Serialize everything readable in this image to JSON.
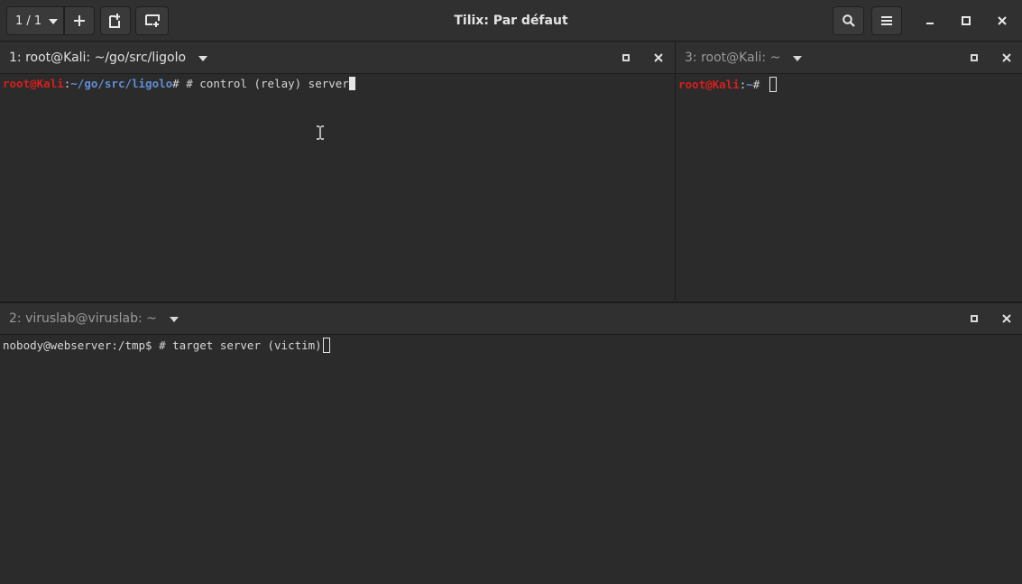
{
  "window": {
    "title": "Tilix: Par défaut",
    "session_counter": "1 / 1"
  },
  "icons": {
    "add": "plus-icon",
    "add_right": "add-terminal-right-icon",
    "add_down": "add-terminal-down-icon",
    "search": "search-icon",
    "menu": "hamburger-menu-icon",
    "minimize": "minimize-icon",
    "maximize": "maximize-icon",
    "close": "close-icon"
  },
  "panes": [
    {
      "title": "1: root@Kali: ~/go/src/ligolo",
      "prompt_user": "root@Kali",
      "prompt_sep": ":",
      "prompt_path": "~/go/src/ligolo",
      "prompt_symbol": "# ",
      "command": "# control (relay) server"
    },
    {
      "title": "3: root@Kali: ~",
      "prompt_user": "root@Kali",
      "prompt_sep": ":",
      "prompt_path": "~",
      "prompt_symbol": "# ",
      "command": ""
    },
    {
      "title": "2: viruslab@viruslab: ~",
      "prompt_text": "nobody@webserver:/tmp$ ",
      "command": "# target server (victim)"
    }
  ],
  "colors": {
    "user": "#d81e1e",
    "path": "#5f8fd6",
    "background": "#2b2b2b"
  }
}
